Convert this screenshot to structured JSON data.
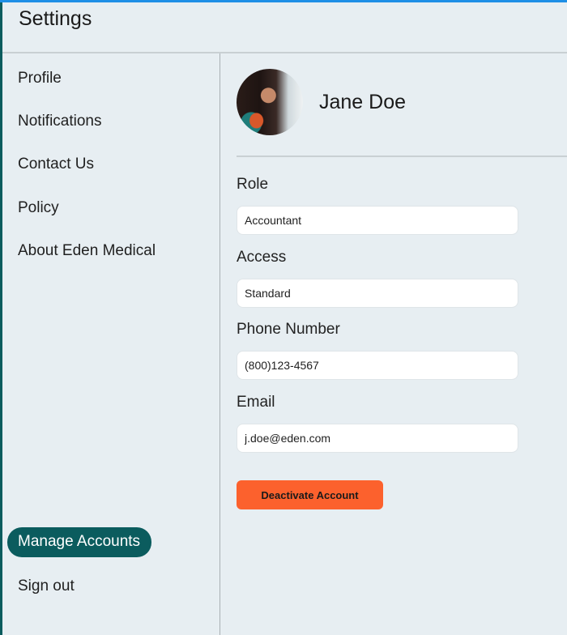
{
  "header": {
    "title": "Settings"
  },
  "sidebar": {
    "items": [
      {
        "label": "Profile"
      },
      {
        "label": "Notifications"
      },
      {
        "label": "Contact Us"
      },
      {
        "label": "Policy"
      },
      {
        "label": "About Eden Medical"
      }
    ],
    "bottom_items": [
      {
        "label": "Manage Accounts",
        "active": true
      },
      {
        "label": "Sign out"
      }
    ]
  },
  "profile": {
    "name": "Jane Doe",
    "avatar": "user-photo"
  },
  "fields": [
    {
      "label": "Role",
      "value": "Accountant"
    },
    {
      "label": "Access",
      "value": "Standard"
    },
    {
      "label": "Phone Number",
      "value": "(800)123-4567"
    },
    {
      "label": "Email",
      "value": "j.doe@eden.com"
    }
  ],
  "actions": {
    "deactivate_label": "Deactivate Account"
  },
  "colors": {
    "accent": "#0b5c5e",
    "danger": "#fc612d",
    "topbar": "#1e8fe6",
    "background": "#e7eef2"
  }
}
